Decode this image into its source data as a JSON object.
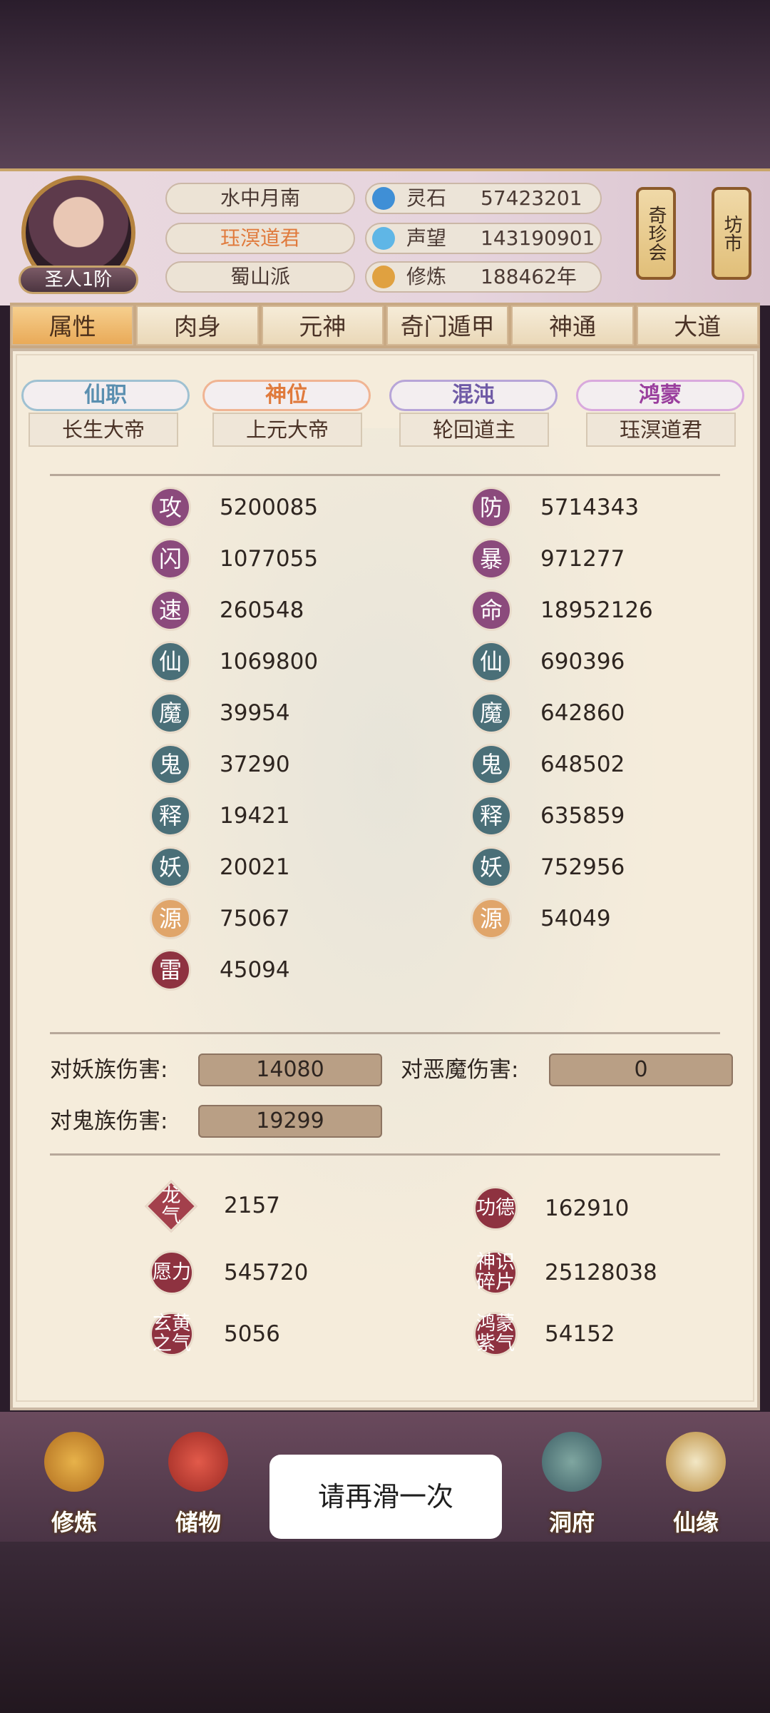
{
  "header": {
    "rank": "圣人1阶",
    "name": "水中月南",
    "title": "珏溟道君",
    "sect": "蜀山派",
    "resources": [
      {
        "icon": "spirit-stone-icon",
        "label": "灵石",
        "value": "57423201"
      },
      {
        "icon": "prestige-icon",
        "label": "声望",
        "value": "143190901"
      },
      {
        "icon": "cultivation-icon",
        "label": "修炼",
        "value": "188462年"
      }
    ],
    "lantern_left": "奇珍会",
    "lantern_right": "坊市"
  },
  "tabs": [
    "属性",
    "肉身",
    "元神",
    "奇门遁甲",
    "神通",
    "大道"
  ],
  "titles": [
    {
      "label": "仙职",
      "value": "长生大帝",
      "color": "#5a8fb0"
    },
    {
      "label": "神位",
      "value": "上元大帝",
      "color": "#e07a3c"
    },
    {
      "label": "混沌",
      "value": "轮回道主",
      "color": "#6f5aa6"
    },
    {
      "label": "鸿蒙",
      "value": "珏溟道君",
      "color": "#9a3f9e"
    }
  ],
  "stats_left": [
    {
      "icon": "攻",
      "value": "5200085"
    },
    {
      "icon": "闪",
      "value": "1077055"
    },
    {
      "icon": "速",
      "value": "260548"
    },
    {
      "icon": "仙",
      "value": "1069800"
    },
    {
      "icon": "魔",
      "value": "39954"
    },
    {
      "icon": "鬼",
      "value": "37290"
    },
    {
      "icon": "释",
      "value": "19421"
    },
    {
      "icon": "妖",
      "value": "20021"
    },
    {
      "icon": "源",
      "value": "75067"
    },
    {
      "icon": "雷",
      "value": "45094"
    }
  ],
  "stats_right": [
    {
      "icon": "防",
      "value": "5714343"
    },
    {
      "icon": "暴",
      "value": "971277"
    },
    {
      "icon": "命",
      "value": "18952126"
    },
    {
      "icon": "仙",
      "value": "690396"
    },
    {
      "icon": "魔",
      "value": "642860"
    },
    {
      "icon": "鬼",
      "value": "648502"
    },
    {
      "icon": "释",
      "value": "635859"
    },
    {
      "icon": "妖",
      "value": "752956"
    },
    {
      "icon": "源",
      "value": "54049"
    }
  ],
  "damage": [
    {
      "label": "对妖族伤害:",
      "value": "14080"
    },
    {
      "label": "对恶魔伤害:",
      "value": "0"
    },
    {
      "label": "对鬼族伤害:",
      "value": "19299"
    }
  ],
  "others_left": [
    {
      "icon": "龙气",
      "value": "2157"
    },
    {
      "icon": "愿力",
      "value": "545720"
    },
    {
      "icon": "玄黄之气",
      "value": "5056"
    }
  ],
  "others_right": [
    {
      "icon": "功德",
      "value": "162910"
    },
    {
      "icon": "神识碎片",
      "value": "25128038"
    },
    {
      "icon": "鸿蒙紫气",
      "value": "54152"
    }
  ],
  "nav": [
    "修炼",
    "储物",
    "洞府",
    "仙缘"
  ],
  "toast": "请再滑一次"
}
